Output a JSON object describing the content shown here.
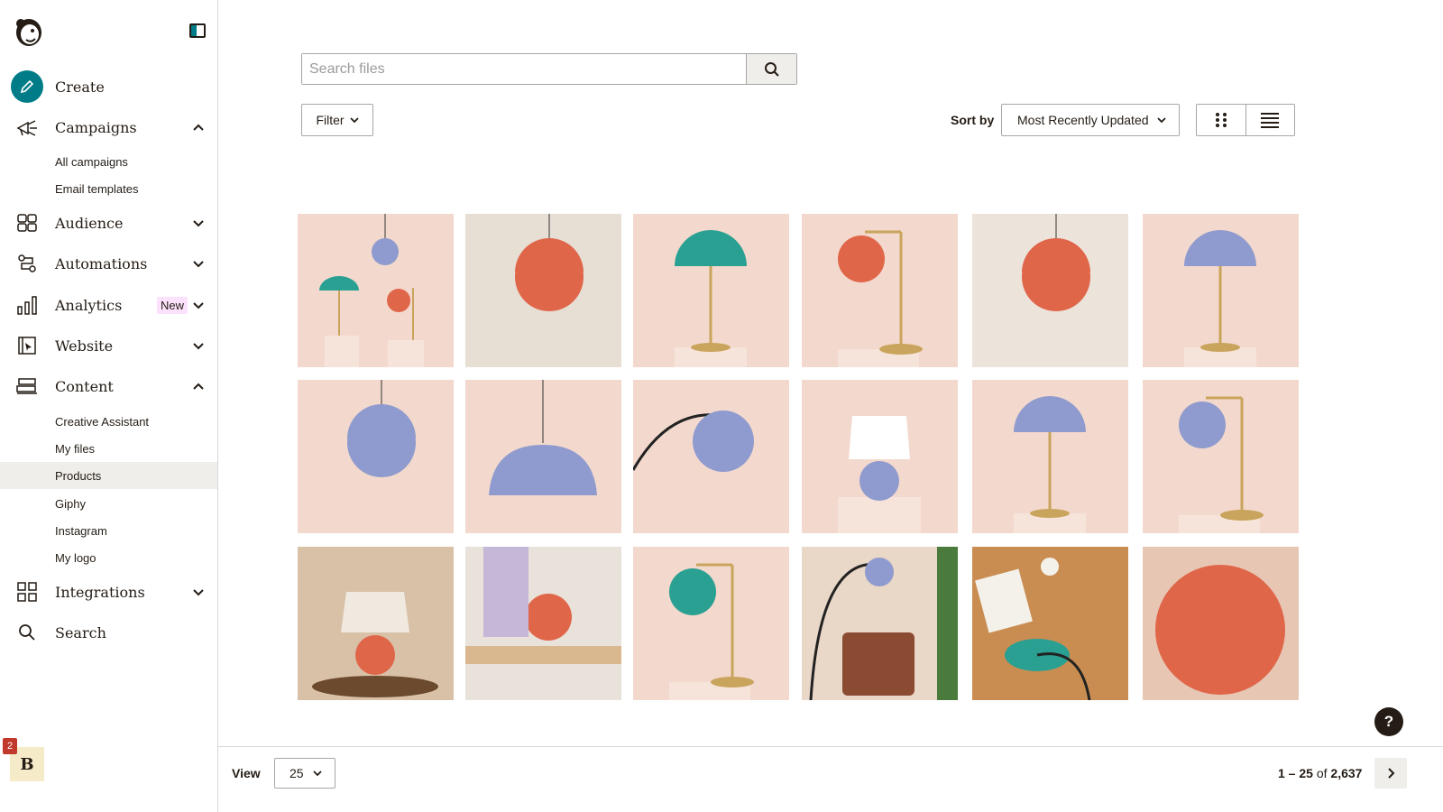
{
  "sidebar": {
    "create": "Create",
    "campaigns": "Campaigns",
    "campaigns_items": [
      "All campaigns",
      "Email templates"
    ],
    "audience": "Audience",
    "automations": "Automations",
    "analytics": "Analytics",
    "analytics_badge": "New",
    "website": "Website",
    "content": "Content",
    "content_items": [
      "Creative Assistant",
      "My files",
      "Products",
      "Giphy",
      "Instagram",
      "My logo"
    ],
    "active_item": "Products",
    "integrations": "Integrations",
    "search": "Search",
    "avatar_initial": "B",
    "notification_count": "2"
  },
  "toolbar": {
    "search_placeholder": "Search files",
    "filter_label": "Filter",
    "sort_label": "Sort by",
    "sort_value": "Most Recently Updated"
  },
  "grid": {
    "images": [
      "lamps-trio",
      "pendant-orange-bathroom",
      "table-lamp-teal",
      "desk-lamp-orange",
      "pendant-orange-kitchen",
      "table-lamp-lavender",
      "pendant-lavender-globe",
      "pendant-lavender-dome",
      "arc-lamp-lavender",
      "table-lamp-white-shade",
      "table-lamp-lavender-small",
      "desk-lamp-lavender",
      "table-lamp-orange-base",
      "workshop-orange-lamp",
      "desk-lamp-teal",
      "arc-lamp-chair",
      "lamp-assembly",
      "orange-sphere"
    ]
  },
  "footer": {
    "view_label": "View",
    "per_page": "25",
    "range": "1 – 25",
    "of": "of",
    "total": "2,637"
  },
  "help": "?",
  "colors": {
    "accent": "#007c89",
    "orange": "#e0664a",
    "teal": "#2aa092",
    "lavender": "#8f9bce",
    "brass": "#c9a45c",
    "bg_peach": "#f3d9cd"
  }
}
